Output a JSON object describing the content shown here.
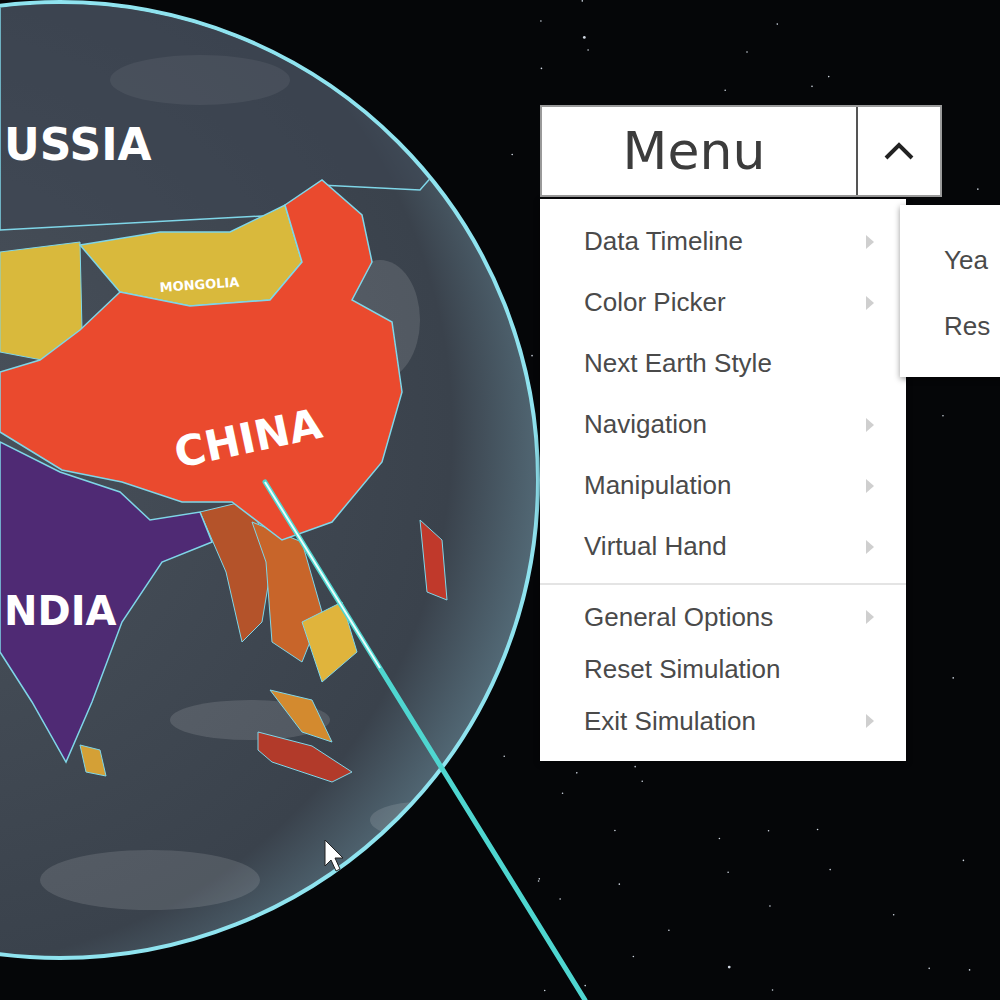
{
  "map": {
    "countries": [
      {
        "name": "USSIA",
        "color": "#3b4452"
      },
      {
        "name": "MONGOLIA",
        "color": "#d9b93c"
      },
      {
        "name": "CHINA",
        "color": "#ea4a2e"
      },
      {
        "name": "NDIA",
        "color": "#4f2a74"
      }
    ],
    "regions": [
      {
        "color": "#d9b93c"
      },
      {
        "color": "#c9a23a"
      },
      {
        "color": "#b4532a"
      },
      {
        "color": "#c8652a"
      },
      {
        "color": "#e0b43c"
      },
      {
        "color": "#d38a2f"
      },
      {
        "color": "#b23a2a"
      },
      {
        "color": "#c0392b"
      },
      {
        "color": "#d4a036"
      }
    ]
  },
  "menu": {
    "title": "Menu",
    "expanded": true,
    "groups": [
      [
        {
          "label": "Data Timeline",
          "has_submenu": true,
          "open": true
        },
        {
          "label": "Color Picker",
          "has_submenu": true,
          "open": false
        },
        {
          "label": "Next Earth Style",
          "has_submenu": false,
          "open": false
        },
        {
          "label": "Navigation",
          "has_submenu": true,
          "open": false
        },
        {
          "label": "Manipulation",
          "has_submenu": true,
          "open": false
        },
        {
          "label": "Virtual Hand",
          "has_submenu": true,
          "open": false
        }
      ],
      [
        {
          "label": "General Options",
          "has_submenu": true,
          "open": false
        },
        {
          "label": "Reset Simulation",
          "has_submenu": false,
          "open": false
        },
        {
          "label": "Exit Simulation",
          "has_submenu": true,
          "open": false
        }
      ]
    ],
    "submenu": {
      "items": [
        "Yea",
        "Res"
      ]
    }
  }
}
